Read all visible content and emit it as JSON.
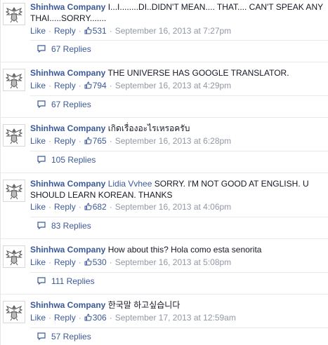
{
  "actions": {
    "like_label": "Like",
    "reply_label": "Reply"
  },
  "comments": [
    {
      "author": "Shinhwa Company",
      "mention": "",
      "text": "I...I........DI..DIDN'T MEAN.... THAT.... CAN'T SPEAK ANY THAI.....SORRY.......",
      "likes": "531",
      "timestamp": "September 16, 2013 at 7:27pm",
      "replies": "67 Replies"
    },
    {
      "author": "Shinhwa Company",
      "mention": "",
      "text": "THE UNIVERSE HAS GOOGLE TRANSLATOR.",
      "likes": "794",
      "timestamp": "September 16, 2013 at 4:29pm",
      "replies": "67 Replies"
    },
    {
      "author": "Shinhwa Company",
      "mention": "",
      "text": "เกิดเรื่องอะไรเหรอครับ",
      "likes": "765",
      "timestamp": "September 16, 2013 at 6:28pm",
      "replies": "105 Replies"
    },
    {
      "author": "Shinhwa Company",
      "mention": "Lidia Vvhee",
      "text": "SORRY. I'M NOT GOOD AT ENGLISH. U SHOULD LEARN KOREAN. THANKS",
      "likes": "682",
      "timestamp": "September 16, 2013 at 4:06pm",
      "replies": "83 Replies"
    },
    {
      "author": "Shinhwa Company",
      "mention": "",
      "text": "How about this? Hola como esta senorita",
      "likes": "530",
      "timestamp": "September 16, 2013 at 5:08pm",
      "replies": "111 Replies"
    },
    {
      "author": "Shinhwa Company",
      "mention": "",
      "text": "한국말 하고싶습니다",
      "likes": "306",
      "timestamp": "September 17, 2013 at 12:59am",
      "replies": "57 Replies"
    }
  ],
  "colors": {
    "link": "#3b5998",
    "meta": "#9197a3",
    "text": "#141823",
    "separator": "#e9eaed"
  },
  "icons": {
    "avatar": "eagle-crest-icon",
    "like": "thumbs-up-icon",
    "replies": "speech-bubble-icon"
  }
}
